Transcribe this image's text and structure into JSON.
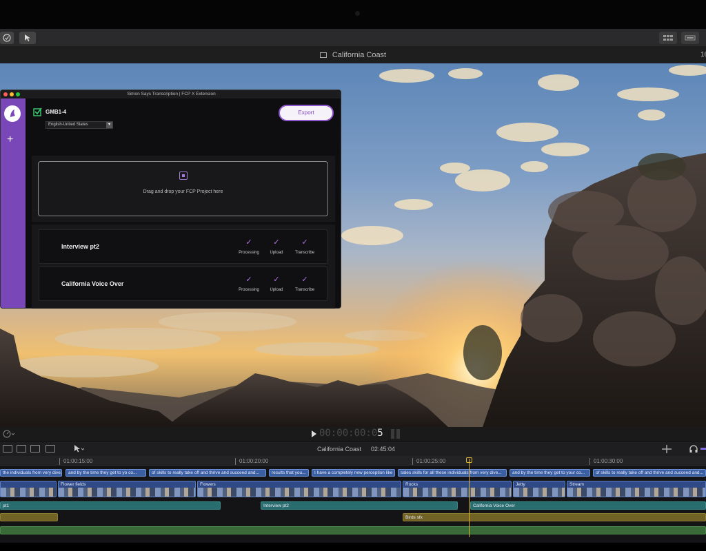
{
  "window": {
    "title": "California Coast"
  },
  "toolbar": {
    "right_number": "16"
  },
  "extension": {
    "title": "Simon Says Transcription | FCP X Extension",
    "project_name": "GMB1-4",
    "language": "English-United States",
    "export_label": "Export",
    "dropzone_text": "Drag and drop your FCP Project here",
    "rows": [
      {
        "name": "Interview pt2",
        "steps": [
          "Processing",
          "Upload",
          "Transcribe"
        ]
      },
      {
        "name": "California Voice Over",
        "steps": [
          "Processing",
          "Upload",
          "Transcribe"
        ]
      }
    ],
    "check_glyph": "✓",
    "accent": "#7a47b8"
  },
  "transport": {
    "timecode_dim": "00:00:00:0",
    "timecode_lit": "5"
  },
  "timeline": {
    "title": "California Coast",
    "duration": "02:45:04",
    "ruler": [
      "01:00:15:00",
      "01:00:20:00",
      "01:00:25:00",
      "01:00:30:00"
    ],
    "captions": [
      "the individuals from very dive...",
      "and by the time they get to yo co...",
      "of skills to really take off and thrive and succeed and...",
      "results that you...",
      "I have a completely new perception like",
      "sales skills for all these individuals from very dive...",
      "and by the time they get to your co...",
      "of skills to really take off and thrive and succeed and..."
    ],
    "video_clips": [
      "",
      "Flower fields",
      "Flowers",
      "Rocks",
      "Jetty",
      "Stream"
    ],
    "audio_clips": [
      "pt1",
      "Interview pt2",
      "California Voice Over",
      "Birds sfx"
    ]
  }
}
